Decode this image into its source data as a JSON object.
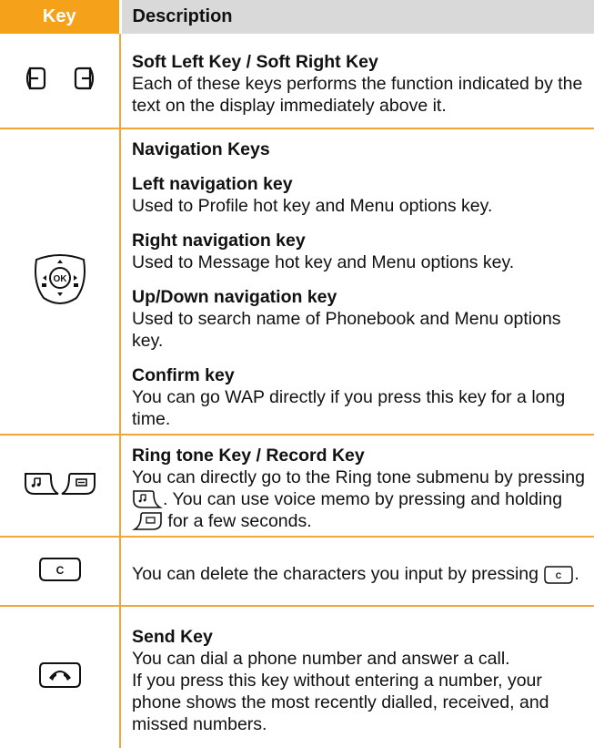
{
  "header": {
    "key": "Key",
    "description": "Description"
  },
  "rows": {
    "softkeys": {
      "icon": "soft-left-right-keys-icon",
      "title": "Soft Left Key / Soft Right Key",
      "text": "Each of these keys performs the function indicated by the text on the display immediately above it."
    },
    "navigation": {
      "icon": "navigation-ok-key-icon",
      "title": "Navigation Keys",
      "left_title": "Left navigation key",
      "left_text": "Used to Profile hot key and Menu options key.",
      "right_title": "Right navigation key",
      "right_text": "Used to Message hot key and Menu options key.",
      "updown_title": "Up/Down navigation key",
      "updown_text": "Used to search name of Phonebook and Menu options key.",
      "confirm_title": "Confirm key",
      "confirm_text": "You can go WAP directly if you press this key for a long time.",
      "ok_label": "OK"
    },
    "ringtone": {
      "icon": "ringtone-record-keys-icon",
      "title": "Ring tone Key / Record Key",
      "text_1": "You can directly go to the Ring tone submenu by pressing",
      "text_2": ". You can use voice memo by pressing and holding",
      "text_3": "for a few seconds."
    },
    "clear": {
      "icon": "clear-key-icon",
      "key_label": "C",
      "text_1": "You can delete the characters you input by pressing",
      "text_2": "."
    },
    "send": {
      "icon": "send-key-icon",
      "title": "Send Key",
      "text_1": "You can dial a phone number and answer a call.",
      "text_2": "If you press this key without entering a number, your phone shows the most recently dialled, received, and missed numbers."
    }
  }
}
